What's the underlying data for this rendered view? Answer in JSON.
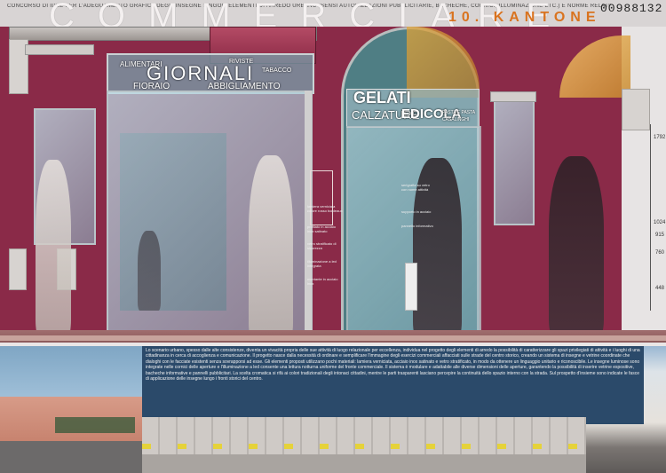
{
  "header": {
    "title": "COMMERCIARE",
    "subtitle": "10. KANTONE",
    "code": "00988132",
    "contest_line": "CONCORSO DI IDEE PER L'ADEGUAMENTO GRAFICA DEGLI INSEGNE SINGOLI ELEMENTI DI ARREDO URBANO (SENSI AUTORIZZAZIONI PUBBLICITARIE, BACHECHE, CORNICI, ILLUMINAZIONE ETC.) E NORME RELATIVE NORMATIVA DI ATTUAZIONE"
  },
  "signs": {
    "left_top": [
      "ALIMENTARI",
      "RIVISTE",
      "TABACCO"
    ],
    "left_main": "GIORNALI",
    "left_bottom": [
      "FIORAIO",
      "ABBIGLIAMENTO"
    ],
    "right_main": "GELATI",
    "right_sub": "CALZATURE",
    "right_third": "EDICOLA",
    "right_small": [
      "PASTA E PASTA",
      "CASALINGHI"
    ]
  },
  "annotations": [
    "lamiera verniciata colore rosso bordeaux",
    "profilato in acciaio inox satinato",
    "vetro stratificato di sicurezza",
    "illuminazione a led integrata",
    "serigrafia su vetro con nome attività",
    "supporto in acciaio",
    "pannello informativo",
    "montante in acciaio inox"
  ],
  "dimensions": [
    "1792",
    "1024",
    "915",
    "760",
    "448"
  ],
  "body_text": "Lo scenario urbano, spesso dalle alte consistenze, diventa un vivacità propria delle sue attività di luogo relazionale per eccellenza, individua nel progetto degli elementi di arredo la possibilità di caratterizzare gli spazi privilegiati di attività e i luoghi di una cittadinanza in cerca di accoglienza e comunicazione. Il progetto nasce dalla necessità di ordinare e semplificare l'immagine degli esercizi commerciali affacciati sulle strade del centro storico, creando un sistema di insegne e vetrine coordinate che dialoghi con le facciate esistenti senza sovrapporsi ad esse. Gli elementi proposti utilizzano pochi materiali: lamiera verniciata, acciaio inox satinato e vetro stratificato, in modo da ottenere un linguaggio unitario e riconoscibile. Le insegne luminose sono integrate nelle cornici delle aperture e l'illuminazione a led consente una lettura notturna uniforme del fronte commerciale. Il sistema è modulare e adattabile alle diverse dimensioni delle aperture, garantendo la possibilità di inserire vetrine espositive, bacheche informative e pannelli pubblicitari. La scelta cromatica si rifà ai colori tradizionali degli intonaci cittadini, mentre le parti trasparenti lasciano percepire la continuità dello spazio interno con la strada. Sul prospetto d'insieme sono indicate le fasce di applicazione delle insegne lungo i fronti storici del centro."
}
